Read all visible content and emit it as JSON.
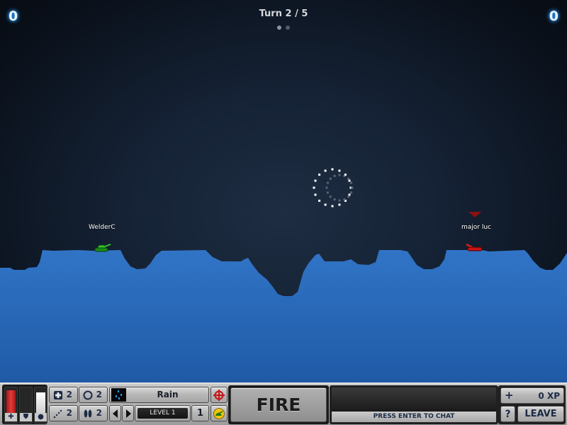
{
  "scores": {
    "left": "0",
    "right": "0"
  },
  "turn": {
    "label": "Turn 2 / 5",
    "dots": [
      true,
      false
    ]
  },
  "players": [
    {
      "name": "WelderC",
      "team": "green",
      "color": "#2fb52a"
    },
    {
      "name": "major luc",
      "team": "red",
      "color": "#d11a1a",
      "active": true
    }
  ],
  "loading_indicator": "loading-spinner",
  "hud": {
    "bars": [
      {
        "name": "health",
        "icon": "plus-icon",
        "level": 0.95,
        "color": "#d42a2a"
      },
      {
        "name": "shield",
        "icon": "shield-icon",
        "level": 0.0,
        "color": "#111111"
      },
      {
        "name": "power",
        "icon": "ball-icon",
        "level": 0.85,
        "color": "#f2f2f2"
      }
    ],
    "items": [
      {
        "name": "repair-kit",
        "icon": "medkit-icon",
        "count": "2"
      },
      {
        "name": "shield-bubble",
        "icon": "ring-icon",
        "count": "2"
      },
      {
        "name": "teleport",
        "icon": "dotted-path-icon",
        "count": "2"
      },
      {
        "name": "footsteps",
        "icon": "footsteps-icon",
        "count": "2"
      }
    ],
    "weapon": {
      "name": "Rain",
      "level": "LEVEL 1",
      "ammo": "1",
      "icon": "rain-icon"
    },
    "fire_label": "FIRE",
    "chat_prompt": "PRESS ENTER TO CHAT",
    "xp": {
      "plus": "+",
      "value": "0 XP"
    },
    "help_label": "?",
    "leave_label": "LEAVE",
    "colors": {
      "accent_blue": "#2a9cff",
      "terrain": "#2e6fbf",
      "navy_text": "#1c2b45"
    }
  }
}
